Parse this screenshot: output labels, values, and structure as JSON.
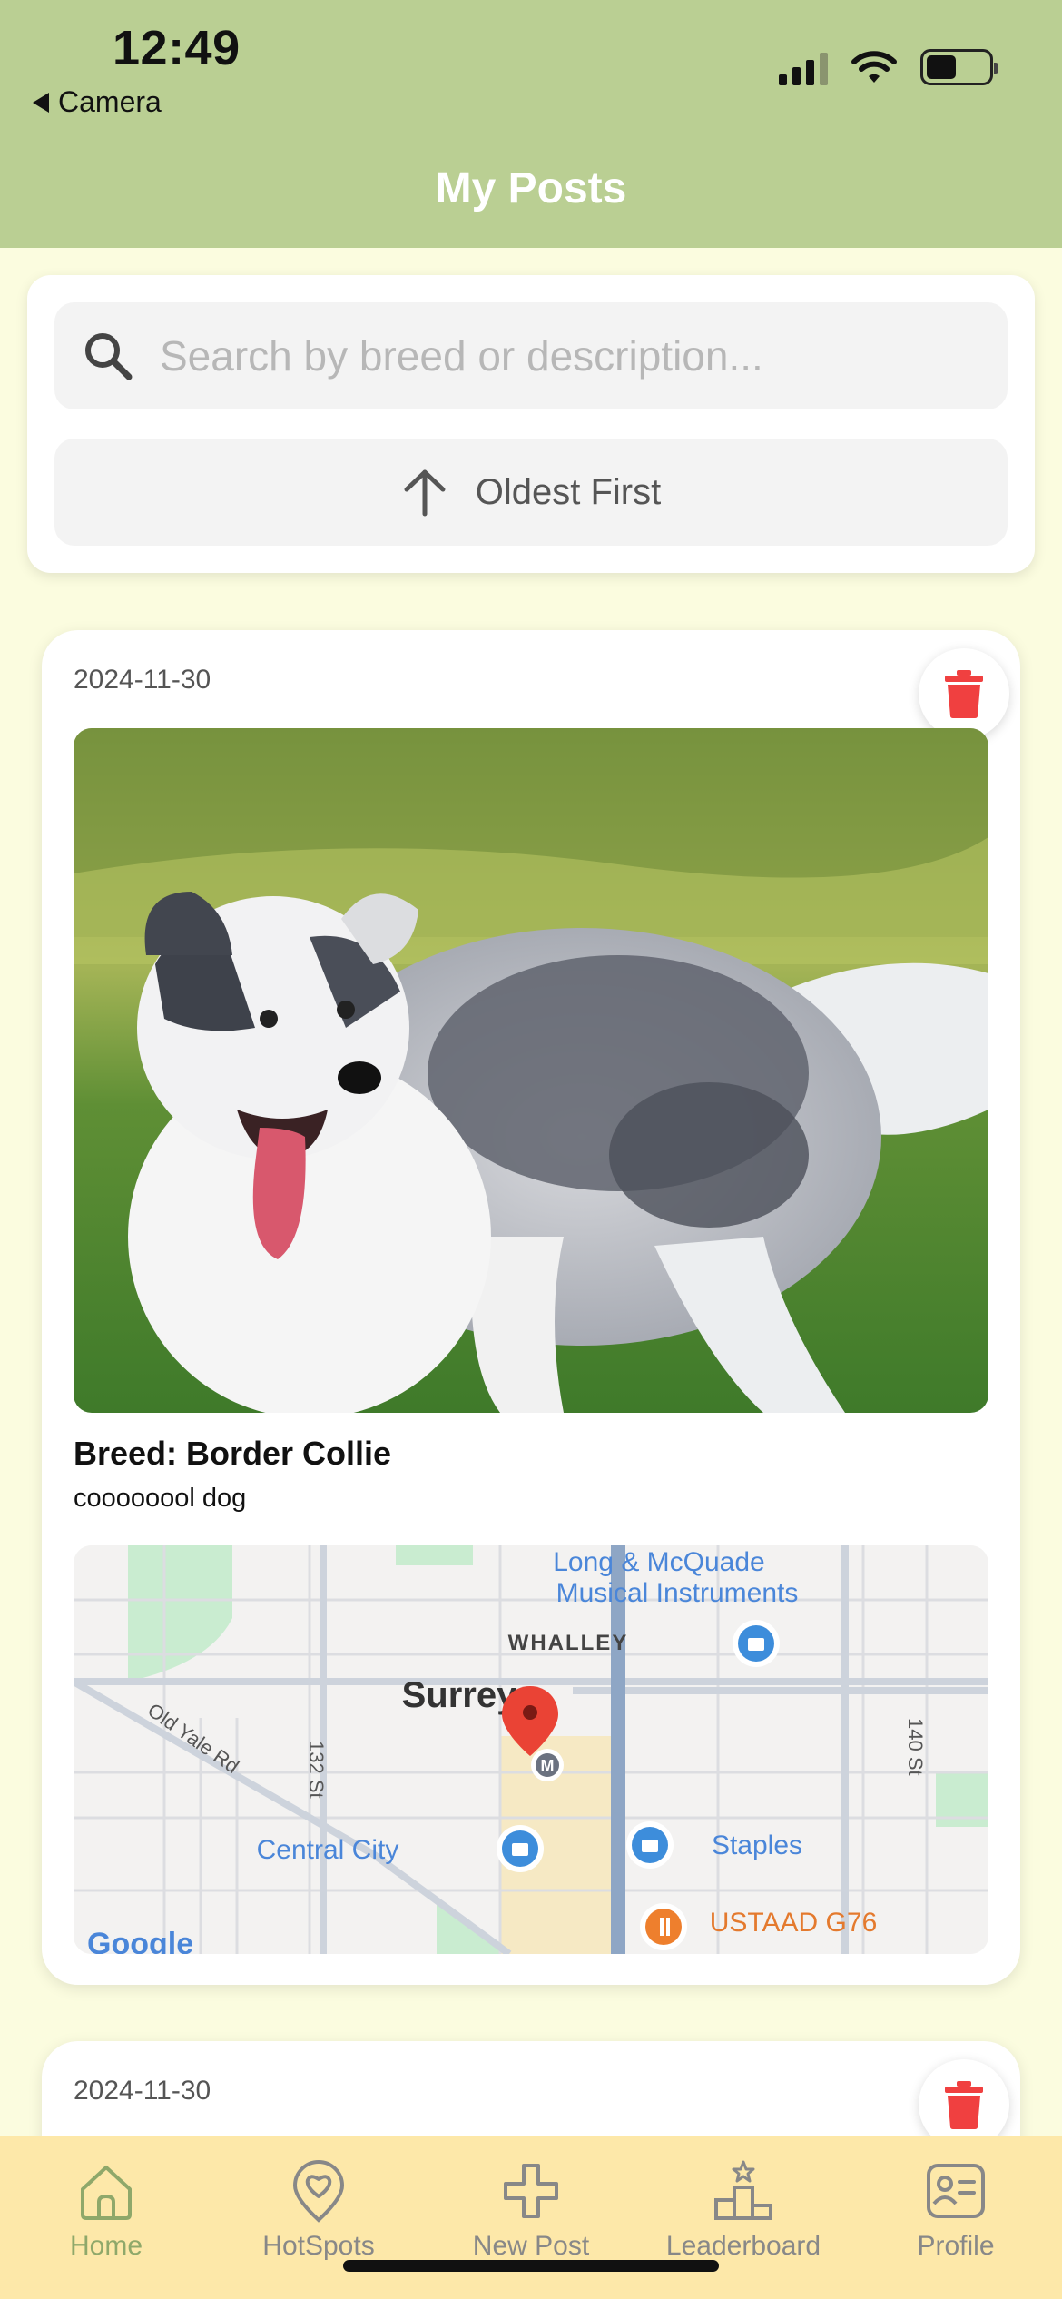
{
  "status_bar": {
    "time": "12:49",
    "back_app": "Camera"
  },
  "header": {
    "title": "My Posts"
  },
  "search": {
    "placeholder": "Search by breed or description...",
    "value": ""
  },
  "sort": {
    "label": "Oldest First"
  },
  "posts": [
    {
      "date": "2024-11-30",
      "breed": "Breed: Border Collie",
      "description": "coooooool dog",
      "map_labels": {
        "poi_1": "Long & McQuade",
        "poi_1b": "Musical Instruments",
        "district": "WHALLEY",
        "city": "Surrey",
        "road_1": "132 St",
        "road_2": "140 St",
        "road_3": "Old Yale Rd",
        "poi_2": "Central City",
        "poi_3": "Staples",
        "poi_4": "USTAAD G76",
        "attribution": "Google"
      }
    },
    {
      "date": "2024-11-30"
    }
  ],
  "tabs": [
    {
      "label": "Home",
      "icon": "home-icon",
      "active": true
    },
    {
      "label": "HotSpots",
      "icon": "heart-pin-icon"
    },
    {
      "label": "New Post",
      "icon": "plus-icon"
    },
    {
      "label": "Leaderboard",
      "icon": "podium-icon"
    },
    {
      "label": "Profile",
      "icon": "profile-card-icon"
    }
  ],
  "colors": {
    "header_bg": "#bacf93",
    "page_bg": "#fbfcdf",
    "tabbar_bg": "#fde8a9",
    "active_tab": "#8fa86a",
    "delete_red": "#f04040"
  }
}
